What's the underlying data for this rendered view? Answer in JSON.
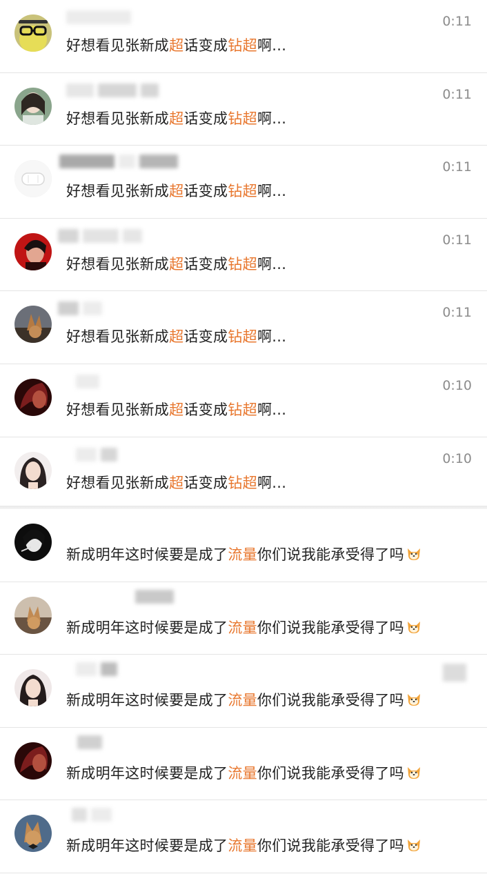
{
  "top_list": [
    {
      "avatar": "anime-glasses-avatar",
      "time": "0:11",
      "msg_pre": "好想看见张新成",
      "msg_hl1": "超",
      "msg_mid": "话变成",
      "msg_hl2": "钻超",
      "msg_post": "啊..."
    },
    {
      "avatar": "girl-portrait-avatar",
      "time": "0:11",
      "msg_pre": "好想看见张新成",
      "msg_hl1": "超",
      "msg_mid": "话变成",
      "msg_hl2": "钻超",
      "msg_post": "啊..."
    },
    {
      "avatar": "white-pillow-avatar",
      "time": "0:11",
      "msg_pre": "好想看见张新成",
      "msg_hl1": "超",
      "msg_mid": "话变成",
      "msg_hl2": "钻超",
      "msg_post": "啊..."
    },
    {
      "avatar": "red-portrait-avatar",
      "time": "0:11",
      "msg_pre": "好想看见张新成",
      "msg_hl1": "超",
      "msg_mid": "话变成",
      "msg_hl2": "钻超",
      "msg_post": "啊..."
    },
    {
      "avatar": "dog-photo-avatar",
      "time": "0:11",
      "msg_pre": "好想看见张新成",
      "msg_hl1": "超",
      "msg_mid": "话变成",
      "msg_hl2": "钻超",
      "msg_post": "啊..."
    },
    {
      "avatar": "dark-red-avatar",
      "time": "0:10",
      "msg_pre": "好想看见张新成",
      "msg_hl1": "超",
      "msg_mid": "话变成",
      "msg_hl2": "钻超",
      "msg_post": "啊..."
    },
    {
      "avatar": "girl-selfie-avatar",
      "time": "0:10",
      "msg_pre": "好想看见张新成",
      "msg_hl1": "超",
      "msg_mid": "话变成",
      "msg_hl2": "钻超",
      "msg_post": "啊..."
    }
  ],
  "bottom_list": [
    {
      "avatar": "bw-portrait-avatar",
      "msg_pre": "新成明年这时候要是成了",
      "msg_hl": "流量",
      "msg_post": "你们说我能承受得了吗",
      "emoji": "dog-face-emoji"
    },
    {
      "avatar": "dog-photo-avatar",
      "msg_pre": "新成明年这时候要是成了",
      "msg_hl": "流量",
      "msg_post": "你们说我能承受得了吗",
      "emoji": "dog-face-emoji"
    },
    {
      "avatar": "girl-selfie-avatar",
      "msg_pre": "新成明年这时候要是成了",
      "msg_hl": "流量",
      "msg_post": "你们说我能承受得了吗",
      "emoji": "dog-face-emoji"
    },
    {
      "avatar": "dark-red-avatar",
      "msg_pre": "新成明年这时候要是成了",
      "msg_hl": "流量",
      "msg_post": "你们说我能承受得了吗",
      "emoji": "dog-face-emoji"
    },
    {
      "avatar": "dog-bowtie-avatar",
      "msg_pre": "新成明年这时候要是成了",
      "msg_hl": "流量",
      "msg_post": "你们说我能承受得了吗",
      "emoji": "dog-face-emoji"
    }
  ],
  "colors": {
    "highlight": "#e8772e",
    "text": "#222222",
    "time": "#8c8c8c",
    "divider": "#e4e4e4"
  }
}
